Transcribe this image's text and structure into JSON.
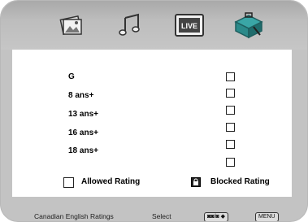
{
  "tabs": [
    {
      "name": "picture-tab",
      "icon": "picture-icon"
    },
    {
      "name": "audio-tab",
      "icon": "music-notes-icon"
    },
    {
      "name": "live-tab",
      "icon": "live-tv-icon",
      "label": "LIVE"
    },
    {
      "name": "setup-tab",
      "icon": "toolbox-icon",
      "active": true
    }
  ],
  "ratings": [
    {
      "label": "G",
      "blocked": false
    },
    {
      "label": "8 ans+",
      "blocked": false
    },
    {
      "label": "13 ans+",
      "blocked": false
    },
    {
      "label": "16 ans+",
      "blocked": false
    },
    {
      "label": "18 ans+",
      "blocked": false
    },
    {
      "label": "",
      "blocked": false
    }
  ],
  "legend": {
    "allowed_label": "Allowed Rating",
    "blocked_label": "Blocked Rating"
  },
  "footer": {
    "title": "Canadian English Ratings",
    "select_label": "Select",
    "nav_key": "◙◙/◙ ◆",
    "menu_key": "MENU"
  },
  "colors": {
    "frame": "#c3c3c3",
    "panel": "#ffffff",
    "active_tab_accent": "#2b8a8a"
  }
}
